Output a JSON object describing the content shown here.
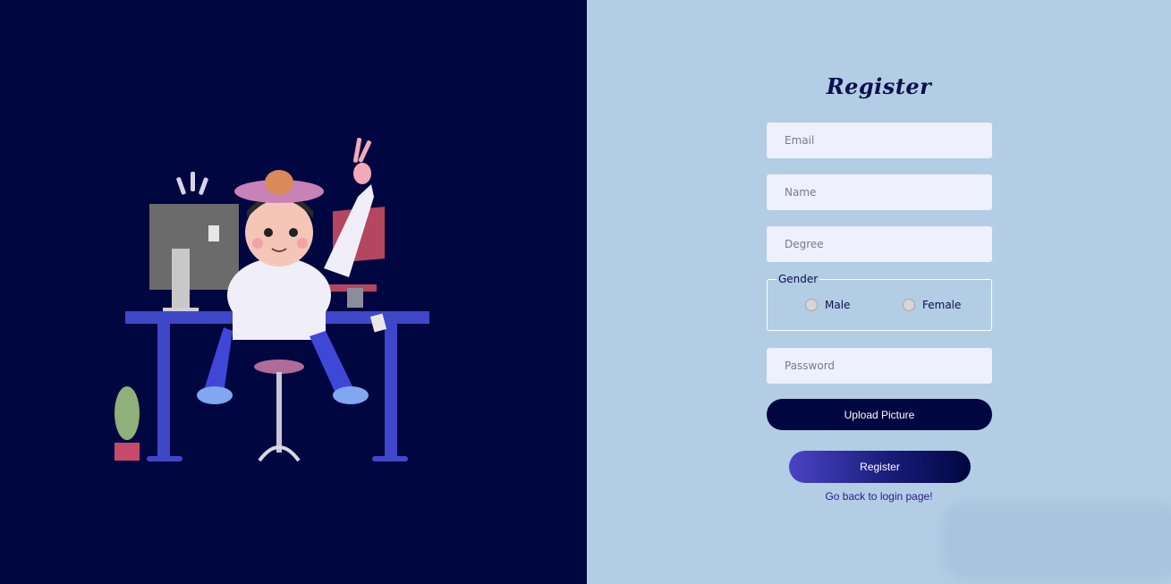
{
  "form": {
    "title": "Register",
    "email_placeholder": "Email",
    "name_placeholder": "Name",
    "degree_placeholder": "Degree",
    "gender_label": "Gender",
    "gender_options": [
      "Male",
      "Female"
    ],
    "password_placeholder": "Password",
    "upload_label": "Upload Picture",
    "register_label": "Register",
    "back_link": "Go back to login page!"
  },
  "colors": {
    "left_background": "#000640",
    "right_background": "#b3cde5",
    "input_background": "#eef0fd",
    "primary_button": "#000640",
    "register_gradient_start": "#4a44c4",
    "link": "#2a1a8a"
  },
  "illustration": "developer-at-desk-illustration"
}
